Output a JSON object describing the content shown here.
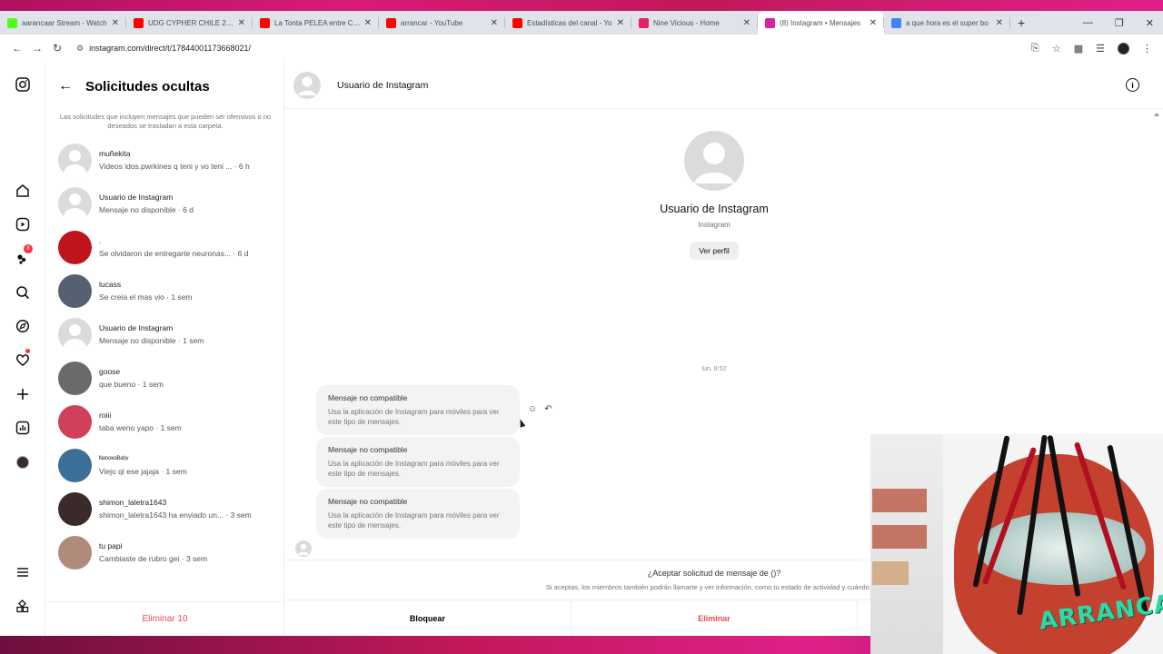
{
  "browser": {
    "tabs": [
      {
        "title": "aarancaar Stream - Watch",
        "favicon_color": "#53fc18"
      },
      {
        "title": "UDG CYPHER CHILE 2026",
        "favicon_color": "#ff0000"
      },
      {
        "title": "La Tonta PELEA entre Crea",
        "favicon_color": "#ff0000"
      },
      {
        "title": "arrancar - YouTube",
        "favicon_color": "#ff0000"
      },
      {
        "title": "Estadísticas del canal - Yo",
        "favicon_color": "#ff0000"
      },
      {
        "title": "Nine Vicious - Home",
        "favicon_color": "#e91e63"
      },
      {
        "title": "(8) Instagram • Mensajes",
        "favicon_color": "#d6249f"
      },
      {
        "title": "a que hora es el super bo",
        "favicon_color": "#4285f4"
      }
    ],
    "new_tab": "+",
    "url": "instagram.com/direct/t/17844001173668021/"
  },
  "sidebar": {
    "notification_count": "8"
  },
  "requests": {
    "title": "Solicitudes ocultas",
    "note": "Las solicitudes que incluyen mensajes que pueden ser ofensivos o no deseados se trasladan a esta carpeta.",
    "items": [
      {
        "name": "muñekita",
        "preview": "Videos idos.pwrkines q teni y vo teni ... · 6 h",
        "avatar": "default"
      },
      {
        "name": "Usuario de Instagram",
        "preview": "Mensaje no disponible · 6 d",
        "avatar": "default"
      },
      {
        "name": ".",
        "preview": "Se olvidaron de entregarte neuronas... · 6 d",
        "avatar": "#c0141d"
      },
      {
        "name": "lucass",
        "preview": "Se creia el mas vio · 1 sem",
        "avatar": "#556070"
      },
      {
        "name": "Usuario de Instagram",
        "preview": "Mensaje no disponible · 1 sem",
        "avatar": "default"
      },
      {
        "name": "goose",
        "preview": "que bueno · 1 sem",
        "avatar": "#6a6a6a"
      },
      {
        "name": "roiii",
        "preview": "taba weno yapo · 1 sem",
        "avatar": "#d0405a"
      },
      {
        "name": "ᴺᵃᵗᶦᵒᶰᵒᴮᵃᵇʸ",
        "preview": "Viejo ql ese jajaja · 1 sem",
        "avatar": "#3b6f97"
      },
      {
        "name": "shimon_laletra1643",
        "preview": "shimon_laletra1643 ha enviado un... · 3 sem",
        "avatar": "#3a2a2a"
      },
      {
        "name": "tu papi",
        "preview": "Cambiaste de rubro gei · 3 sem",
        "avatar": "#b08a7a"
      }
    ],
    "delete_all": "Eliminar 10"
  },
  "conversation": {
    "header_name": "Usuario de Instagram",
    "profile_name": "Usuario de Instagram",
    "profile_sub": "Instagram",
    "view_profile": "Ver perfil",
    "timestamp": "lun. 8:52",
    "messages": [
      {
        "title": "Mensaje no compatible",
        "body": "Usa la aplicación de Instagram para móviles para ver este tipo de mensajes."
      },
      {
        "title": "Mensaje no compatible",
        "body": "Usa la aplicación de Instagram para móviles para ver este tipo de mensajes."
      },
      {
        "title": "Mensaje no compatible",
        "body": "Usa la aplicación de Instagram para móviles para ver este tipo de mensajes."
      }
    ],
    "request_question": "¿Aceptar solicitud de mensaje de ()?",
    "request_desc": "Si aceptas, los miembros también podrán llamarte y ver información, como tu estado de actividad y cuándo has",
    "block": "Bloquear",
    "delete": "Eliminar"
  },
  "overlay": {
    "logo_text": "ARRANCAR"
  }
}
